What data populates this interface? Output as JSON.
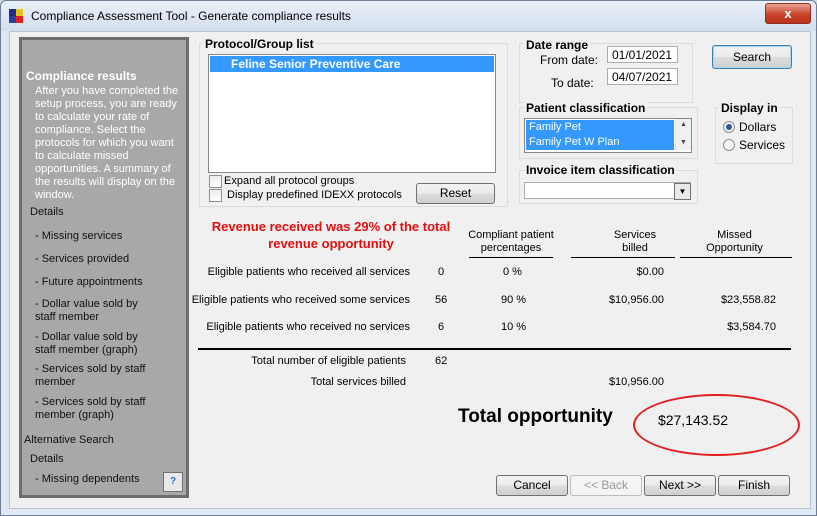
{
  "window": {
    "title": "Compliance Assessment Tool - Generate compliance results",
    "close_label": "x"
  },
  "left_panel": {
    "heading": "Compliance results",
    "description": "After you have completed the setup process, you are ready to calculate your rate of compliance. Select the protocols for which you want to calculate missed opportunities. A summary of the results will display on the window.",
    "details1": "Details",
    "items": [
      "- Missing services",
      "- Services provided",
      "- Future appointments",
      "- Dollar value sold by staff member",
      "- Dollar value sold by staff member (graph)",
      "- Services sold by staff member",
      "- Services sold by staff member (graph)"
    ],
    "alt_search": "Alternative Search",
    "details2": "Details",
    "missing_dependents": "- Missing dependents",
    "help_icon": "?"
  },
  "protocol": {
    "label": "Protocol/Group list",
    "items": [
      "Feline Senior Preventive Care"
    ],
    "expand_label": "Expand all protocol groups",
    "idexx_label": "Display predefined IDEXX protocols",
    "reset_label": "Reset"
  },
  "date_range": {
    "label": "Date range",
    "from_label": "From date:",
    "from_value": "01/01/2021",
    "to_label": "To date:",
    "to_value": "04/07/2021"
  },
  "search_label": "Search",
  "patient_class": {
    "label": "Patient classification",
    "items": [
      "Family Pet",
      "Family Pet W Plan"
    ]
  },
  "display_in": {
    "label": "Display in",
    "options": [
      "Dollars",
      "Services"
    ],
    "selected": "Dollars"
  },
  "invoice": {
    "label": "Invoice item classification",
    "value": ""
  },
  "summary": {
    "message": "Revenue received was 29% of the total revenue opportunity",
    "col_headers": [
      "Compliant patient percentages",
      "Services billed",
      "Missed Opportunity"
    ],
    "rows": [
      {
        "label": "Eligible patients who received all services",
        "count": "0",
        "pct": "0 %",
        "billed": "$0.00",
        "missed": ""
      },
      {
        "label": "Eligible patients who received some services",
        "count": "56",
        "pct": "90 %",
        "billed": "$10,956.00",
        "missed": "$23,558.82"
      },
      {
        "label": "Eligible patients who received no services",
        "count": "6",
        "pct": "10 %",
        "billed": "",
        "missed": "$3,584.70"
      }
    ],
    "total_patients_label": "Total number of eligible patients",
    "total_patients": "62",
    "total_billed_label": "Total services billed",
    "total_billed": "$10,956.00",
    "total_opportunity_label": "Total opportunity",
    "total_opportunity": "$27,143.52"
  },
  "footer": {
    "cancel": "Cancel",
    "back": "<< Back",
    "next": "Next >>",
    "finish": "Finish"
  }
}
